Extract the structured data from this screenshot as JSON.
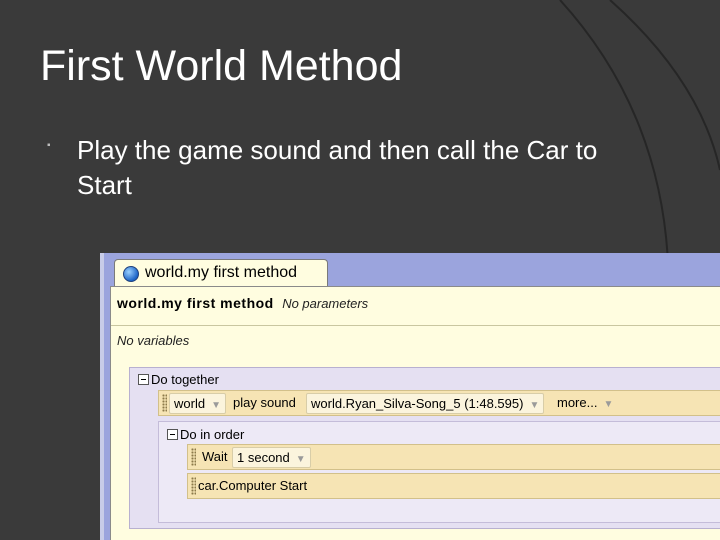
{
  "slide": {
    "title": "First World Method",
    "bullet": "Play the game sound and then call the Car to Start"
  },
  "editor": {
    "tab_label": "world.my first method",
    "method_name": "world.my first method",
    "parameters": "No parameters",
    "variables": "No variables",
    "do_together": {
      "label": "Do together",
      "statement": {
        "object": "world",
        "method": "play sound",
        "sound": "world.Ryan_Silva-Song_5 (1:48.595)",
        "more": "more..."
      }
    },
    "do_in_order": {
      "label": "Do in order",
      "wait": {
        "label": "Wait",
        "value": "1 second"
      },
      "call": "car.Computer Start"
    }
  },
  "colors": {
    "slide_bg": "#3a3a3a",
    "editor_frame": "#9ba4dd",
    "panel": "#fffde0",
    "code_bg": "#e5e0f2",
    "statement": "#f6e4b4"
  }
}
